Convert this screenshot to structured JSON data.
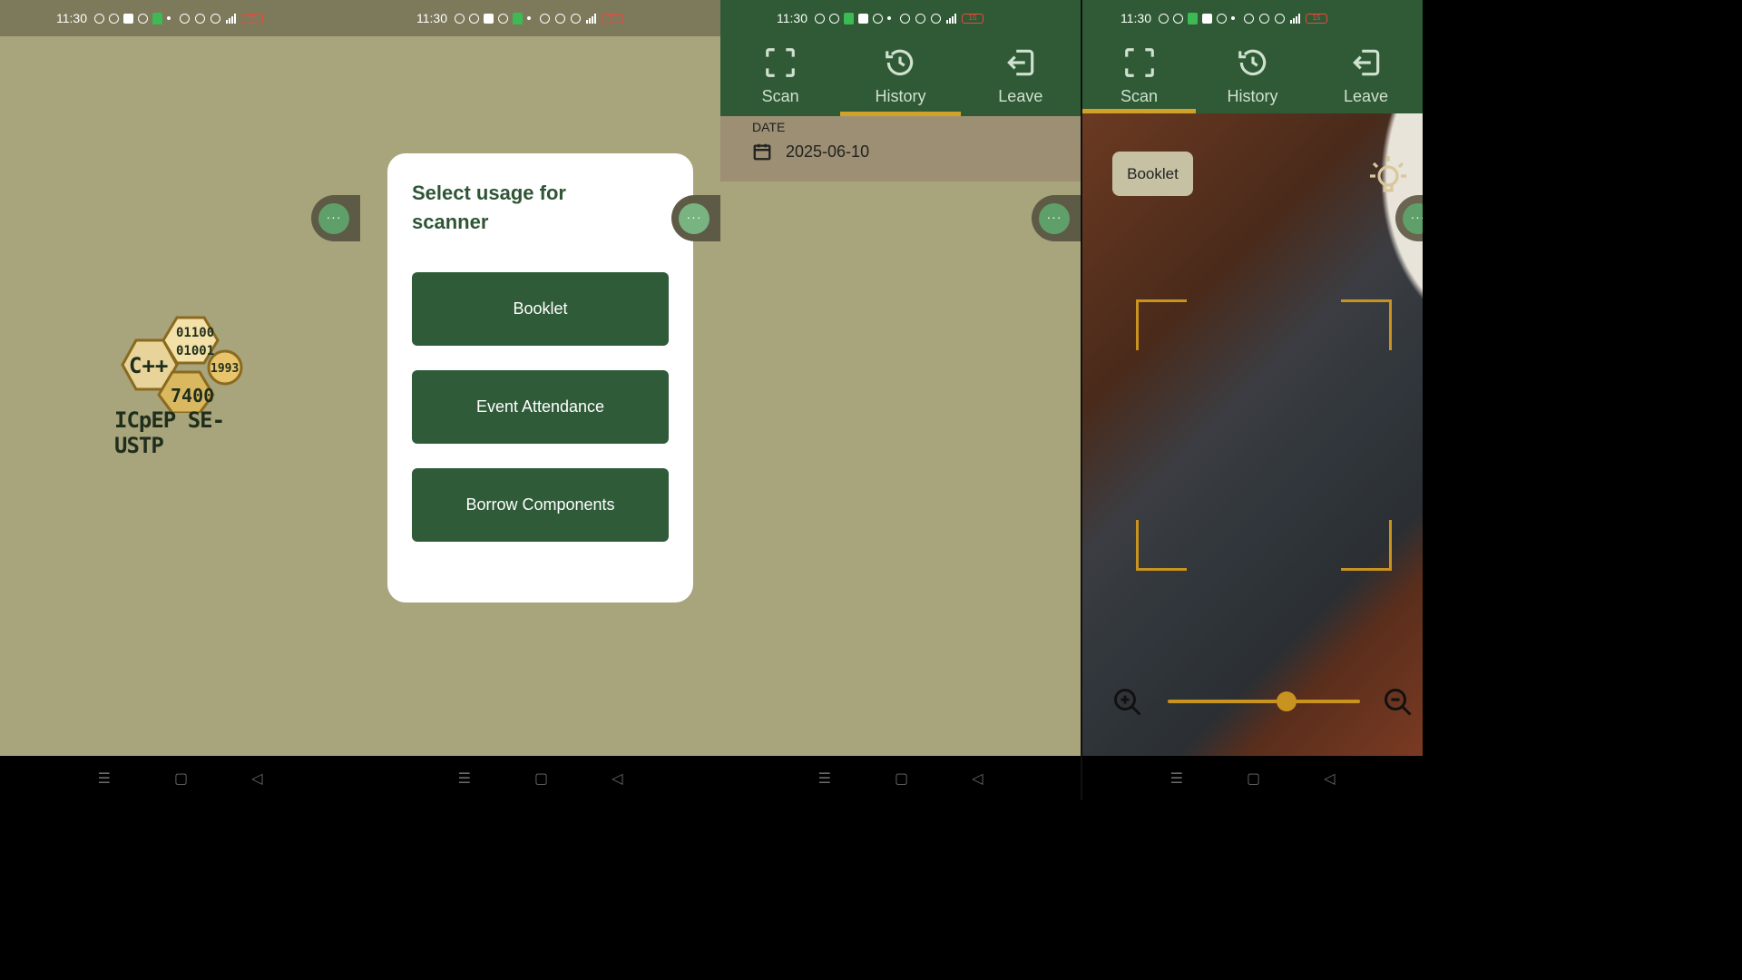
{
  "status": {
    "time": "11:30",
    "battery": "15"
  },
  "logo": {
    "lang": "C++",
    "binary_1": "01100",
    "binary_2": "01001",
    "year": "1993",
    "code": "7400",
    "org": "ICpEP SE-USTP"
  },
  "chat_head": {
    "label": "···"
  },
  "dialog": {
    "title": "Select usage for scanner",
    "options": [
      "Booklet",
      "Event Attendance",
      "Borrow Components"
    ]
  },
  "tabs": [
    {
      "label": "Scan",
      "icon": "scan-icon"
    },
    {
      "label": "History",
      "icon": "history-icon"
    },
    {
      "label": "Leave",
      "icon": "leave-icon"
    }
  ],
  "history": {
    "active_tab": "History",
    "date_label": "DATE",
    "date_value": "2025-06-10"
  },
  "scanner": {
    "active_tab": "Scan",
    "usage_chip": "Booklet",
    "zoom_level": 0.62
  },
  "nav": {
    "menu": "☰",
    "home": "▢",
    "back": "◁"
  },
  "colors": {
    "primary": "#2f5b38",
    "accent": "#d1a22a",
    "background": "#a8a47c"
  }
}
